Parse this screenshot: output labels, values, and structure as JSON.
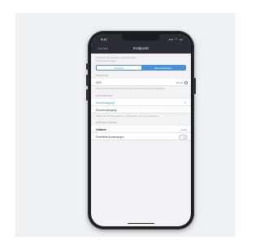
{
  "screen": {
    "status": {
      "time": "9:41",
      "signal": "▪▪▪ ◠ ▭"
    },
    "navbar": {
      "back_label": "‹ Zurück",
      "title": "Endpunkt"
    },
    "intro": {
      "line1": "Anzeigen und Verwalten des Endpunkts",
      "line2": "Geräteeinstellungen"
    },
    "segment": {
      "left": "Standard",
      "right": "Benutzerdefiniert"
    },
    "position": {
      "header": "Position",
      "row_label": "GPS",
      "row_value": "Bereit",
      "note": "Für die Aktivierung der Position wird eine Verbindung zum Gerät benötigt."
    },
    "ordering": {
      "header": "Sortierung",
      "rows": [
        {
          "label": "Sonnenaufgang",
          "selected": true
        },
        {
          "label": "Sonnenuntergang",
          "selected": false
        }
      ],
      "note": "Wählen Sie die Reihenfolge, in der Einträge in der Liste erscheinen."
    },
    "settings": {
      "header": "Einstellungen",
      "rows": [
        {
          "label": "Zeitzone",
          "value": "Lokal"
        },
        {
          "label": "Erweiterte Anpassungen",
          "toggle": false
        }
      ]
    }
  },
  "colors": {
    "accent": "#4a90d9",
    "navbar": "#2b2d33",
    "phone_frame": "#1c1d20",
    "card_bg": "#eef1f4"
  }
}
